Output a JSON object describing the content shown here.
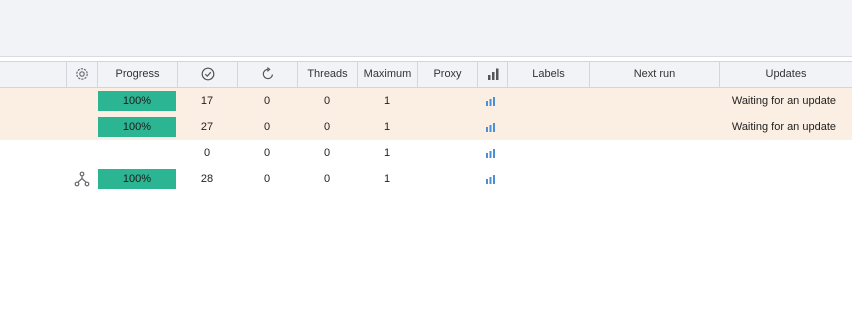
{
  "columns": {
    "settings_icon": "gear-icon",
    "progress": "Progress",
    "success_icon": "check-circle-icon",
    "retry_icon": "refresh-icon",
    "threads": "Threads",
    "maximum": "Maximum",
    "proxy": "Proxy",
    "stats_icon": "bar-chart-icon",
    "labels": "Labels",
    "next_run": "Next run",
    "updates": "Updates"
  },
  "rows": [
    {
      "highlighted": true,
      "branch_icon": false,
      "progress": "100%",
      "success": "17",
      "retries": "0",
      "threads": "0",
      "maximum": "1",
      "updates": "Waiting for an update"
    },
    {
      "highlighted": true,
      "branch_icon": false,
      "progress": "100%",
      "success": "27",
      "retries": "0",
      "threads": "0",
      "maximum": "1",
      "updates": "Waiting for an update"
    },
    {
      "highlighted": false,
      "branch_icon": false,
      "progress": "",
      "success": "0",
      "retries": "0",
      "threads": "0",
      "maximum": "1",
      "updates": ""
    },
    {
      "highlighted": false,
      "branch_icon": true,
      "progress": "100%",
      "success": "28",
      "retries": "0",
      "threads": "0",
      "maximum": "1",
      "updates": ""
    }
  ],
  "colors": {
    "progress_fill": "#2cb592",
    "row_highlight": "#fbefe3",
    "header_bg": "#f2f3f7",
    "icon_gray": "#666a72",
    "icon_blue": "#4a90d9"
  }
}
